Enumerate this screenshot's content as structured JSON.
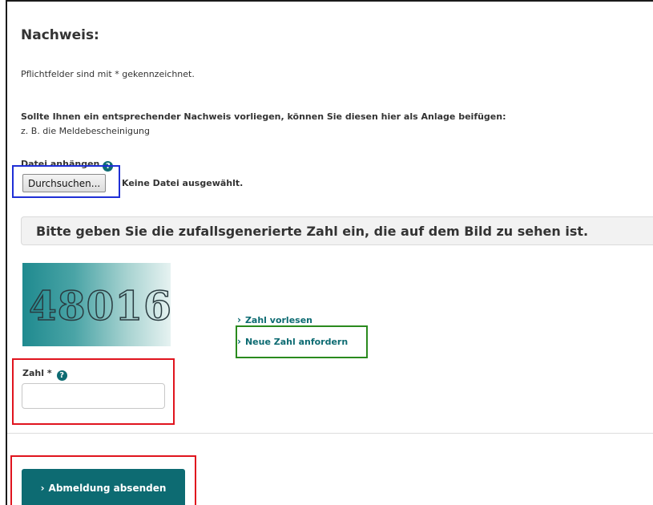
{
  "section": {
    "heading": "Nachweis:",
    "required_note": "Pflichtfelder sind mit * gekennzeichnet.",
    "attach_intro": "Sollte Ihnen ein entsprechender Nachweis vorliegen, können Sie diesen hier als Anlage beifügen:",
    "attach_example": "z. B. die Meldebescheinigung"
  },
  "file_upload": {
    "label": "Datei anhängen",
    "button_label": "Durchsuchen...",
    "status": "Keine Datei ausgewählt."
  },
  "captcha": {
    "instruction": "Bitte geben Sie die zufallsgenerierte Zahl ein, die auf dem Bild zu sehen ist.",
    "image_digits": "48016",
    "read_aloud_link": "Zahl vorlesen",
    "new_number_link": "Neue Zahl anfordern",
    "field_label": "Zahl *",
    "field_value": ""
  },
  "submit": {
    "label": "Abmeldung absenden"
  },
  "icons": {
    "help": "help-icon",
    "chevron": "chevron-right-icon"
  },
  "colors": {
    "accent": "#0d6b72",
    "highlight_blue": "#1f2fd6",
    "highlight_green": "#2a8a1e",
    "highlight_red": "#e0141e"
  }
}
